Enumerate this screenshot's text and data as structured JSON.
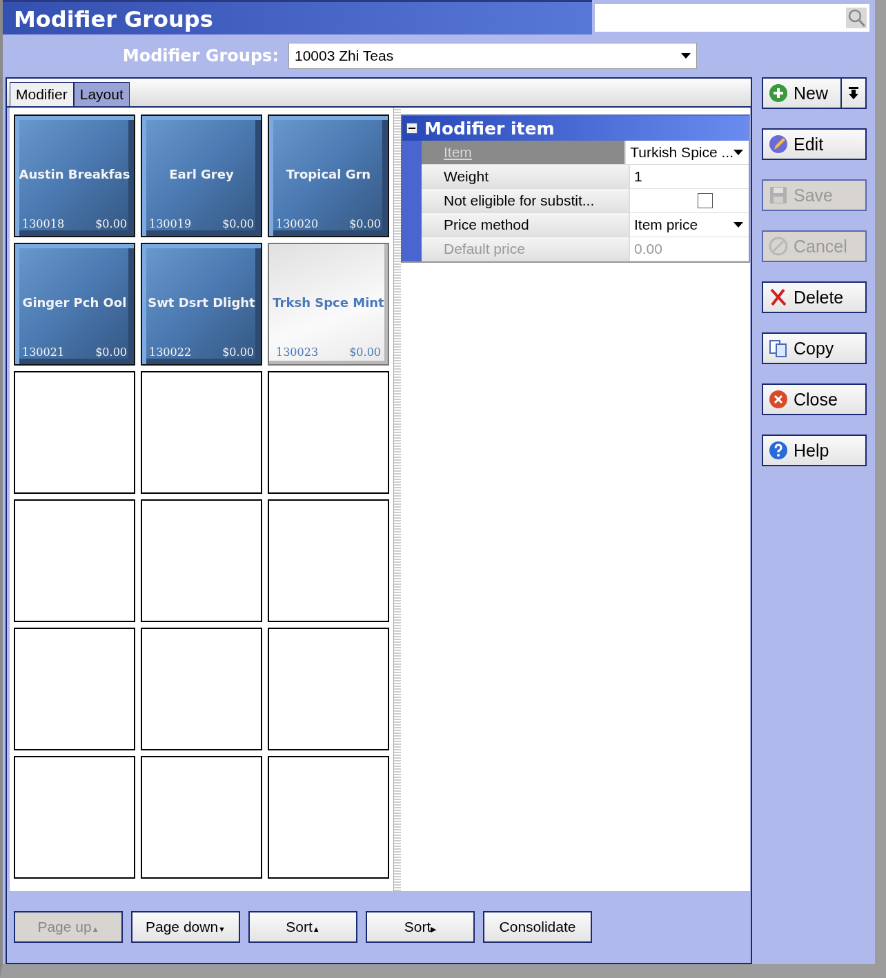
{
  "window": {
    "title": "Modifier Groups"
  },
  "group_selector": {
    "label": "Modifier Groups:",
    "value": "10003 Zhi Teas"
  },
  "tabs": [
    {
      "label": "Modifier",
      "selected": false
    },
    {
      "label": "Layout",
      "selected": true
    }
  ],
  "tiles": [
    {
      "kind": "item",
      "name": "Austin Breakfas",
      "code": "130018",
      "price": "$0.00",
      "selected": false
    },
    {
      "kind": "item",
      "name": "Earl Grey",
      "code": "130019",
      "price": "$0.00",
      "selected": false
    },
    {
      "kind": "item",
      "name": "Tropical Grn",
      "code": "130020",
      "price": "$0.00",
      "selected": false
    },
    {
      "kind": "item",
      "name": "Ginger Pch Ool",
      "code": "130021",
      "price": "$0.00",
      "selected": false
    },
    {
      "kind": "item",
      "name": "Swt Dsrt Dlight",
      "code": "130022",
      "price": "$0.00",
      "selected": false
    },
    {
      "kind": "item",
      "name": "Trksh Spce Mint",
      "code": "130023",
      "price": "$0.00",
      "selected": true
    },
    {
      "kind": "empty"
    },
    {
      "kind": "empty"
    },
    {
      "kind": "empty"
    },
    {
      "kind": "empty"
    },
    {
      "kind": "empty"
    },
    {
      "kind": "empty"
    },
    {
      "kind": "empty"
    },
    {
      "kind": "empty"
    },
    {
      "kind": "empty"
    },
    {
      "kind": "empty"
    },
    {
      "kind": "empty"
    },
    {
      "kind": "empty"
    }
  ],
  "properties": {
    "title": "Modifier item",
    "expanded": true,
    "rows": [
      {
        "label": "Item",
        "kind": "dropdown",
        "value": "Turkish Spice ...",
        "selected": true,
        "disabled": false
      },
      {
        "label": "Weight",
        "kind": "text",
        "value": "1",
        "selected": false,
        "disabled": false
      },
      {
        "label": "Not eligible for substit...",
        "kind": "checkbox",
        "checked": false,
        "selected": false,
        "disabled": false
      },
      {
        "label": "Price method",
        "kind": "dropdown",
        "value": "Item price",
        "selected": false,
        "disabled": false
      },
      {
        "label": "Default price",
        "kind": "text",
        "value": "0.00",
        "selected": false,
        "disabled": true
      }
    ]
  },
  "bottom_buttons": [
    {
      "label": "Page up",
      "arrow": "▲",
      "disabled": true
    },
    {
      "label": "Page down",
      "arrow": "▼",
      "disabled": false
    },
    {
      "label": "Sort",
      "arrow": "▲",
      "disabled": false
    },
    {
      "label": "Sort",
      "arrow": "▶",
      "disabled": false
    },
    {
      "label": "Consolidate",
      "disabled": false
    }
  ],
  "side_buttons": [
    {
      "label": "New",
      "kind": "new",
      "disabled": false,
      "split": true
    },
    {
      "label": "Edit",
      "kind": "edit",
      "disabled": false
    },
    {
      "label": "Save",
      "kind": "save",
      "disabled": true
    },
    {
      "label": "Cancel",
      "kind": "cancel",
      "disabled": true
    },
    {
      "label": "Delete",
      "kind": "delete",
      "disabled": false
    },
    {
      "label": "Copy",
      "kind": "copy",
      "disabled": false
    },
    {
      "label": "Close",
      "kind": "close",
      "disabled": false
    },
    {
      "label": "Help",
      "kind": "help",
      "disabled": false
    }
  ]
}
